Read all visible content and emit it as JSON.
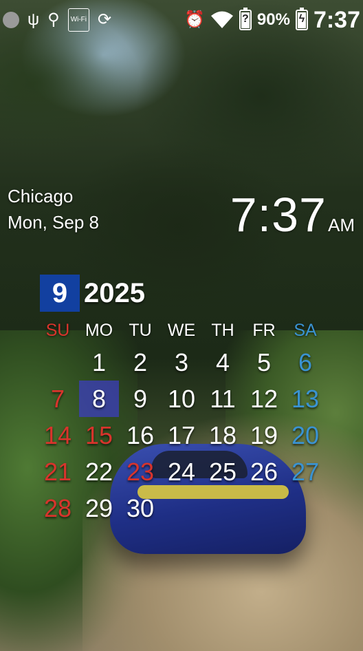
{
  "status_bar": {
    "left_icons": [
      "notification-dot-icon",
      "usb-icon",
      "location-badge-icon",
      "wifi-badge-icon",
      "sync-icon"
    ],
    "wifi_badge_text": "Wi-Fi",
    "right_icons": [
      "alarm-icon",
      "wifi-signal-icon",
      "battery-unknown-icon",
      "battery-charging-icon"
    ],
    "battery_percent": "90%",
    "time": "7:37"
  },
  "clock_widget": {
    "city": "Chicago",
    "date": "Mon, Sep 8",
    "time": "7:37",
    "ampm": "AM"
  },
  "calendar": {
    "month": "9",
    "year": "2025",
    "weekdays": [
      "SU",
      "MO",
      "TU",
      "WE",
      "TH",
      "FR",
      "SA"
    ],
    "weeks": [
      [
        "",
        "1",
        "2",
        "3",
        "4",
        "5",
        "6"
      ],
      [
        "7",
        "8",
        "9",
        "10",
        "11",
        "12",
        "13"
      ],
      [
        "14",
        "15",
        "16",
        "17",
        "18",
        "19",
        "20"
      ],
      [
        "21",
        "22",
        "23",
        "24",
        "25",
        "26",
        "27"
      ],
      [
        "28",
        "29",
        "30",
        "",
        "",
        "",
        ""
      ]
    ],
    "today": "8",
    "holidays_red": [
      "15",
      "23"
    ],
    "colors": {
      "today_highlight": "#3c3ebe",
      "month_box": "#1240a0",
      "sunday": "#d8342c",
      "saturday": "#3a93d2",
      "weekday": "#ffffff"
    }
  }
}
